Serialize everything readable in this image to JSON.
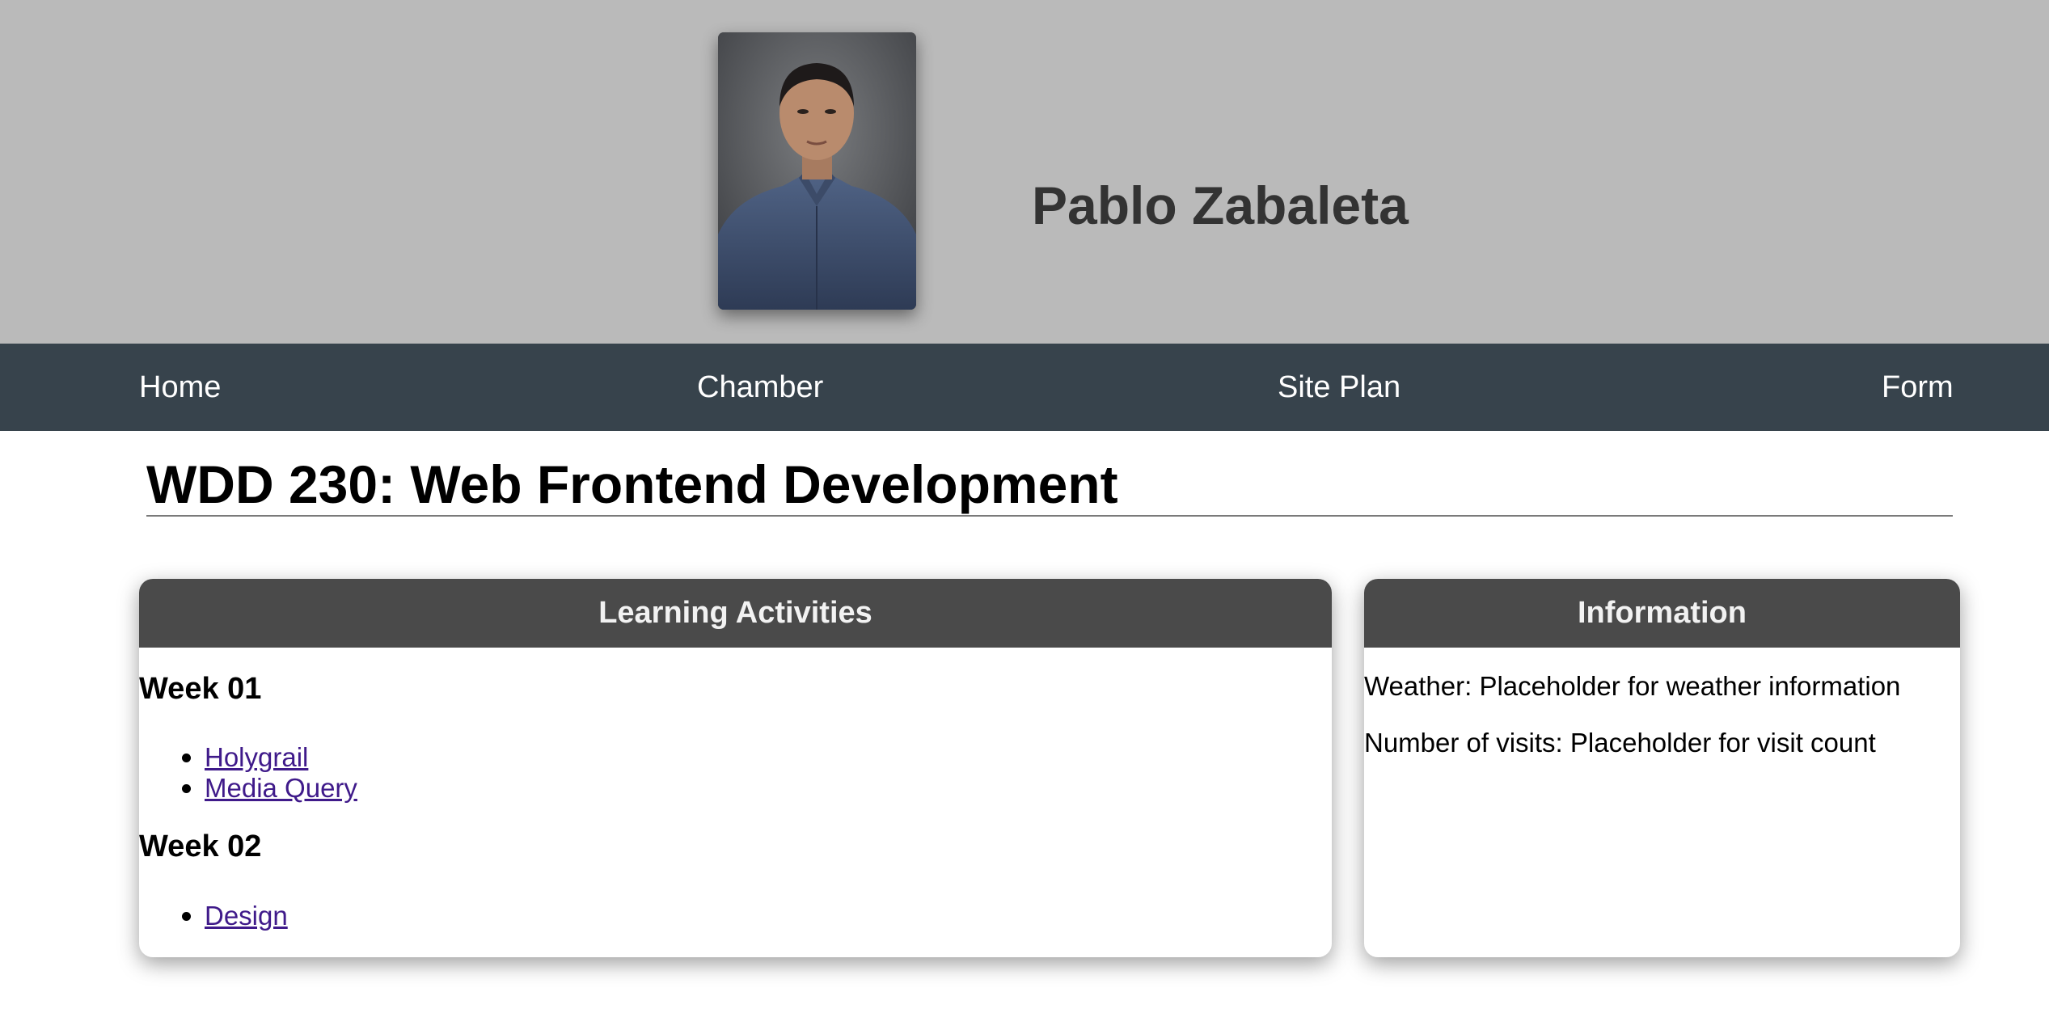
{
  "header": {
    "name": "Pablo Zabaleta",
    "portrait_alt": "profile photo"
  },
  "nav": {
    "items": [
      {
        "label": "Home"
      },
      {
        "label": "Chamber"
      },
      {
        "label": "Site Plan"
      },
      {
        "label": "Form"
      }
    ]
  },
  "main": {
    "title": "WDD 230: Web Frontend Development"
  },
  "activities": {
    "heading": "Learning Activities",
    "weeks": [
      {
        "label": "Week 01",
        "links": [
          "Holygrail",
          "Media Query"
        ]
      },
      {
        "label": "Week 02",
        "links": [
          "Design"
        ]
      }
    ]
  },
  "information": {
    "heading": "Information",
    "weather": "Weather: Placeholder for weather information",
    "visits": "Number of visits: Placeholder for visit count"
  },
  "colors": {
    "header_bg": "#bababa",
    "nav_bg": "#37434c",
    "card_head_bg": "#4a4a4a",
    "link": "#3f1a8a"
  }
}
